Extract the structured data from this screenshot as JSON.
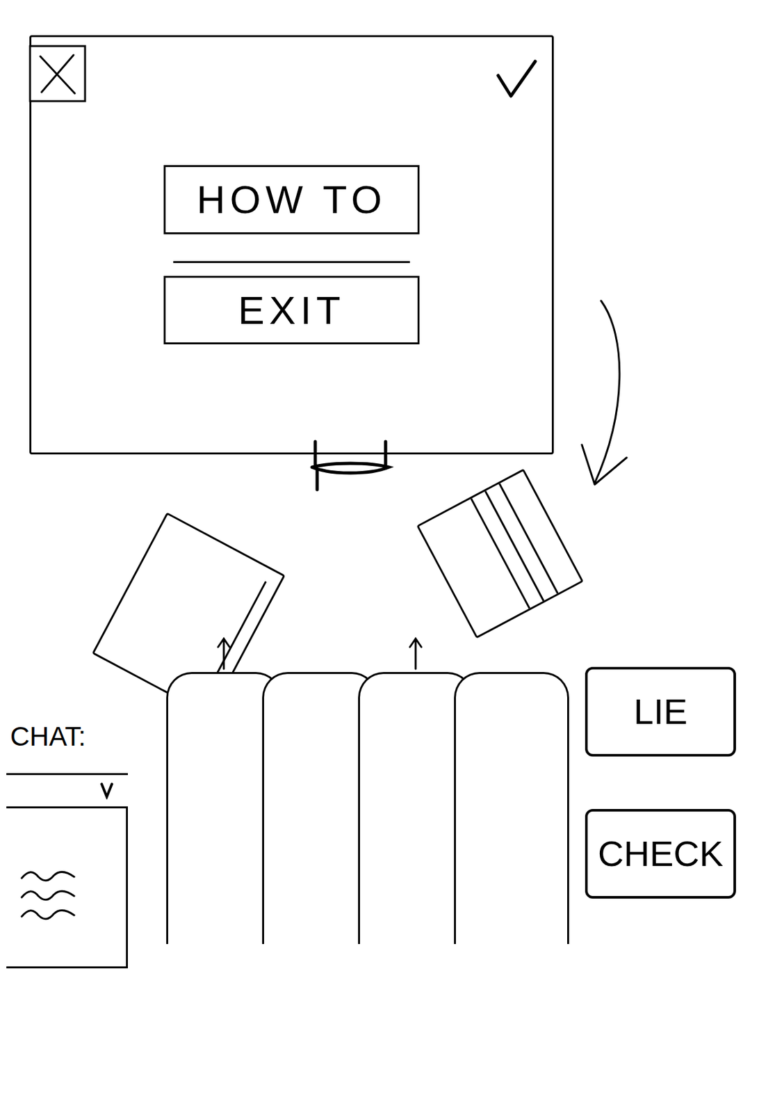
{
  "menu": {
    "buttons": [
      {
        "label": "HOW TO"
      },
      {
        "label": "EXIT"
      }
    ]
  },
  "played_cards": [
    {
      "kind": "blank"
    },
    {
      "kind": "lined"
    }
  ],
  "hand": [
    {
      "selected": true
    },
    {
      "selected": false
    },
    {
      "selected": true
    },
    {
      "selected": false
    }
  ],
  "actions": [
    "LIE",
    "CHECK"
  ],
  "chat": {
    "label": "CHAT:"
  }
}
